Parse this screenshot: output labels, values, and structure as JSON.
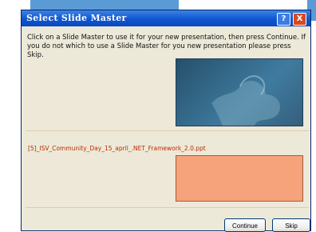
{
  "dialog": {
    "title": "Select Slide Master",
    "help_label": "?",
    "close_label": "X",
    "instruction": "Click on a Slide Master to use it for your new presentation, then press Continue. If you do not which to use a Slide Master for you new presentation please press Skip.",
    "file_label": "[5]_ISV_Community_Day_15_april_.NET_Framework_2.0.ppt",
    "buttons": {
      "continue": "Continue",
      "skip": "Skip"
    }
  },
  "colors": {
    "title_bar": "#0f56cf",
    "preview_blue": "#3f7ba0",
    "preview_orange": "#f6a27a",
    "file_label": "#c02a00"
  },
  "icons": {
    "help": "help-icon",
    "close": "close-icon"
  }
}
